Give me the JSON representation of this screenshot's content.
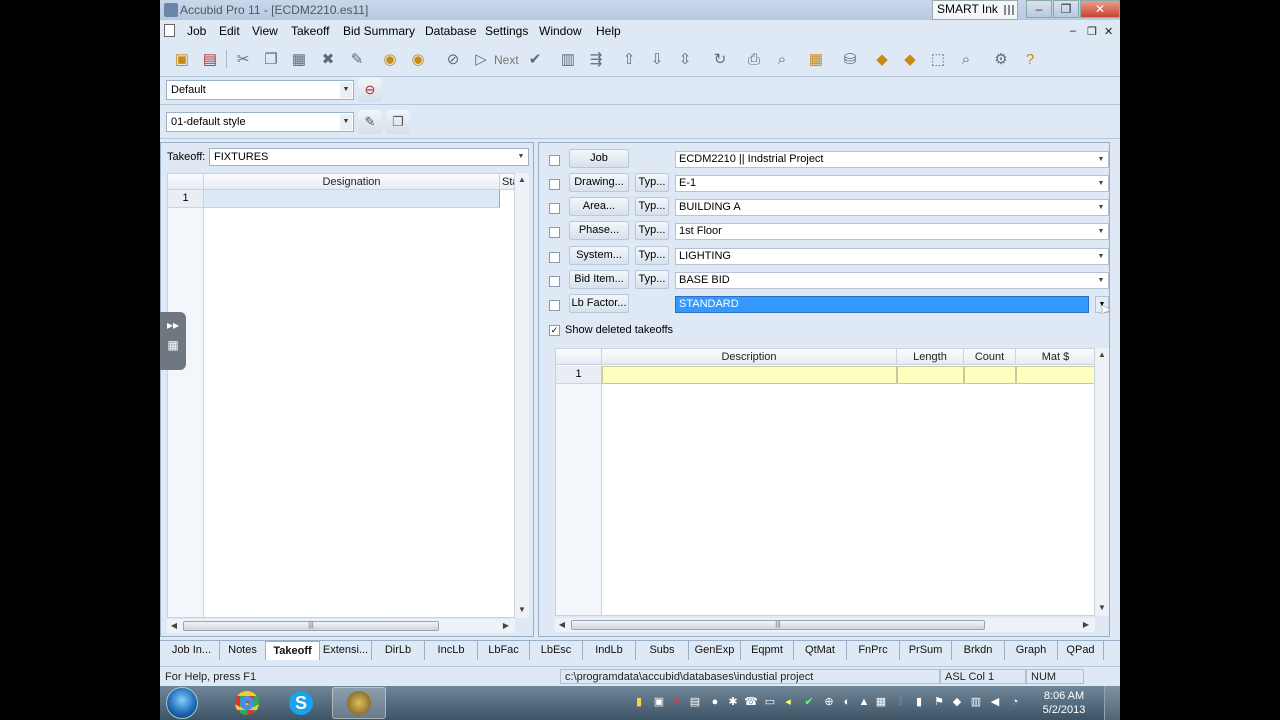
{
  "window": {
    "title": "Accubid Pro 11 - [ECDM2210.es11]",
    "smart_ink": "SMART Ink",
    "controls": {
      "minimize": "–",
      "restore": "❐",
      "close": "✕"
    },
    "mdi_controls": {
      "minimize": "–",
      "restore": "❐",
      "close": "✕"
    }
  },
  "menu": [
    "Job",
    "Edit",
    "View",
    "Takeoff",
    "Bid Summary",
    "Database",
    "Settings",
    "Window",
    "Help"
  ],
  "toolbar": {
    "next_label": "Next",
    "icons": [
      "save-icon",
      "job-info-icon",
      "cut-icon",
      "copy-icon",
      "paste-icon",
      "delete-icon",
      "edit-icon",
      "prev-icon",
      "next-arrow-icon",
      "stop-icon",
      "play-icon",
      "check-icon",
      "assembly-icon",
      "wire-icon",
      "up-arrow-icon",
      "down-arrow-icon",
      "expand-icon",
      "refresh-icon",
      "print-icon",
      "preview-icon",
      "calculator-icon",
      "database-icon",
      "tool-a-icon",
      "tool-b-icon",
      "tool-c-icon",
      "tool-d-icon",
      "settings-icon",
      "help-icon"
    ]
  },
  "style_selectors": {
    "default_value": "Default",
    "style_value": "01-default style"
  },
  "left_panel": {
    "takeoff_label": "Takeoff:",
    "takeoff_value": "FIXTURES",
    "grid_columns": [
      "Designation",
      "Sta"
    ],
    "rows": [
      {
        "num": "1"
      }
    ]
  },
  "right_panel": {
    "fields": [
      {
        "label": "Job",
        "typ": "",
        "value": "ECDM2210 || Indstrial Project"
      },
      {
        "label": "Drawing...",
        "typ": "Typ...",
        "value": "E-1"
      },
      {
        "label": "Area...",
        "typ": "Typ...",
        "value": "BUILDING A"
      },
      {
        "label": "Phase...",
        "typ": "Typ...",
        "value": "1st Floor"
      },
      {
        "label": "System...",
        "typ": "Typ...",
        "value": "LIGHTING"
      },
      {
        "label": "Bid Item...",
        "typ": "Typ...",
        "value": "BASE BID"
      },
      {
        "label": "Lb Factor...",
        "typ": "",
        "value": "STANDARD"
      }
    ],
    "show_deleted_label": "Show deleted takeoffs",
    "show_deleted_checked": true,
    "grid_columns": [
      "Description",
      "Length",
      "Count",
      "Mat $"
    ],
    "rows": [
      {
        "num": "1"
      }
    ]
  },
  "tabs": [
    "Job In...",
    "Notes",
    "Takeoff",
    "Extensi...",
    "DirLb",
    "IncLb",
    "LbFac",
    "LbEsc",
    "IndLb",
    "Subs",
    "GenExp",
    "Eqpmt",
    "QtMat",
    "FnPrc",
    "PrSum",
    "Brkdn",
    "Graph",
    "QPad"
  ],
  "active_tab": "Takeoff",
  "status": {
    "help": "For Help, press F1",
    "path": "c:\\programdata\\accubid\\databases\\industial project",
    "position": "ASL Col 1",
    "num": "NUM"
  },
  "taskbar": {
    "time": "8:06 AM",
    "date": "5/2/2013"
  }
}
